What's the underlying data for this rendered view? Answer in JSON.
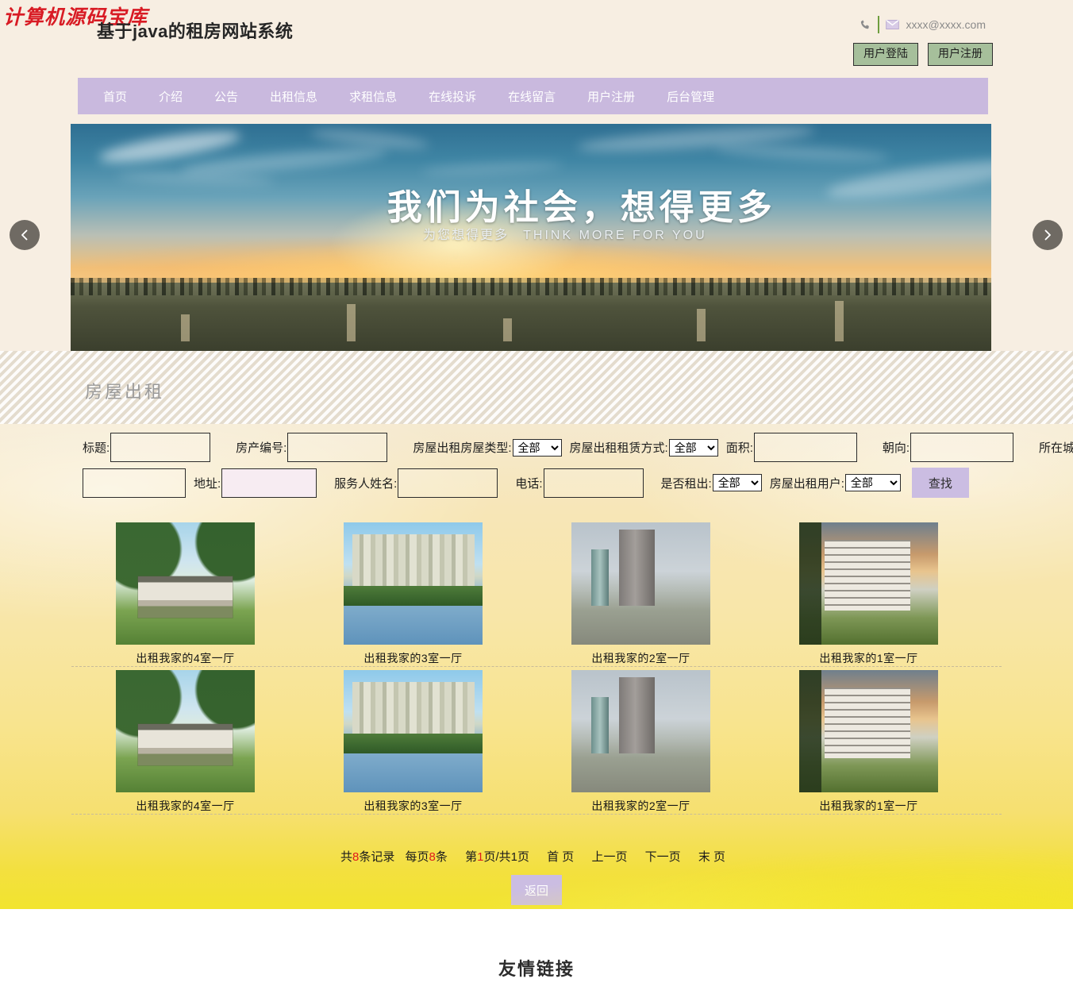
{
  "header": {
    "watermark": "计算机源码宝库",
    "site_title": "基于java的租房网站系统",
    "phone_icon": "phone-icon",
    "mail_icon": "mail-icon",
    "email": "xxxx@xxxx.com",
    "login_label": "用户登陆",
    "register_label": "用户注册"
  },
  "nav": {
    "items": [
      {
        "label": "首页"
      },
      {
        "label": "介绍"
      },
      {
        "label": "公告"
      },
      {
        "label": "出租信息"
      },
      {
        "label": "求租信息"
      },
      {
        "label": "在线投诉"
      },
      {
        "label": "在线留言"
      },
      {
        "label": "用户注册"
      },
      {
        "label": "后台管理"
      }
    ]
  },
  "banner": {
    "headline": "我们为社会，想得更多",
    "subline_cn": "为您想得更多",
    "subline_en": "THINK MORE FOR YOU",
    "prev_icon": "chevron-left-icon",
    "next_icon": "chevron-right-icon"
  },
  "section": {
    "title": "房屋出租"
  },
  "search": {
    "labels": {
      "title": "标题:",
      "property_no": "房产编号:",
      "house_type": "房屋出租房屋类型:",
      "rent_mode": "房屋出租租赁方式:",
      "area": "面积:",
      "orientation": "朝向:",
      "city": "所在城市:",
      "address": "地址:",
      "agent_name": "服务人姓名:",
      "phone": "电话:",
      "is_rented": "是否租出:",
      "rent_user": "房屋出租用户:"
    },
    "values": {
      "title": "",
      "property_no": "",
      "house_type": "全部",
      "rent_mode": "全部",
      "area": "",
      "orientation": "",
      "city": "",
      "address": "",
      "agent_name": "",
      "phone": "",
      "is_rented": "全部",
      "rent_user": "全部"
    },
    "select_options": [
      "全部"
    ],
    "search_label": "查找"
  },
  "listing": {
    "rows": [
      {
        "cards": [
          {
            "label": "出租我家的4室一厅",
            "thumb": "villa-thumb"
          },
          {
            "label": "出租我家的3室一厅",
            "thumb": "lakeside-apartments-thumb"
          },
          {
            "label": "出租我家的2室一厅",
            "thumb": "city-tower-thumb"
          },
          {
            "label": "出租我家的1室一厅",
            "thumb": "sunset-apartments-thumb"
          }
        ]
      },
      {
        "cards": [
          {
            "label": "出租我家的4室一厅",
            "thumb": "villa-thumb"
          },
          {
            "label": "出租我家的3室一厅",
            "thumb": "lakeside-apartments-thumb"
          },
          {
            "label": "出租我家的2室一厅",
            "thumb": "city-tower-thumb"
          },
          {
            "label": "出租我家的1室一厅",
            "thumb": "sunset-apartments-thumb"
          }
        ]
      }
    ]
  },
  "pagination": {
    "total_prefix": "共",
    "total_count": "8",
    "total_suffix": "条记录",
    "per_page_prefix": "每页",
    "per_page_count": "8",
    "per_page_suffix": "条",
    "page_prefix": "第",
    "current_page": "1",
    "page_mid": "页/共1页",
    "first_page": "首 页",
    "prev_page": "上一页",
    "next_page": "下一页",
    "last_page": "末 页",
    "back_label": "返回"
  },
  "footer": {
    "title": "友情链接"
  },
  "colors": {
    "nav_bg": "#c9b9de",
    "accent_purple": "#cbbde2",
    "auth_btn_bg": "#a6bf9b",
    "page_cream": "#f7eee2",
    "content_yellow": "#f8e48e",
    "highlight_red": "#e01b1b"
  }
}
